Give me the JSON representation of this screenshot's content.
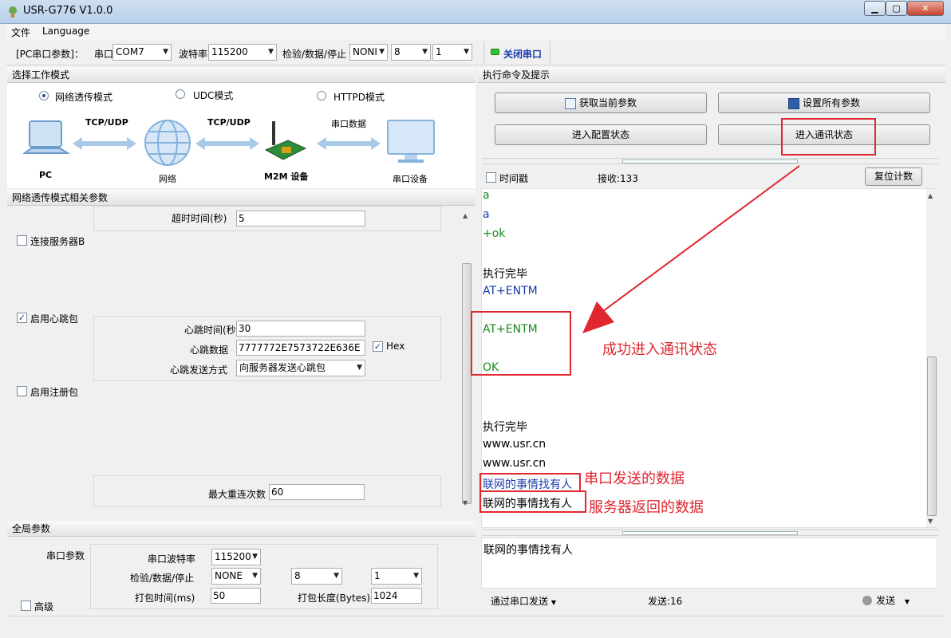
{
  "window": {
    "title": "USR-G776 V1.0.0",
    "btn_min": "▁",
    "btn_max": "▢",
    "btn_close": "✕"
  },
  "menu": [
    "文件",
    "Language"
  ],
  "toolbar": {
    "port_group_label": "[PC串口参数]：",
    "port_label": "串口号",
    "port_value": "COM7",
    "baud_label": "波特率",
    "baud_value": "115200",
    "check_label": "检验/数据/停止",
    "parity_value": "NONI",
    "data_bits_value": "8",
    "stop_bits_value": "1",
    "close_port_label": "关闭串口"
  },
  "left": {
    "mode_header": "选择工作模式",
    "modes": [
      "网络透传模式",
      "UDC模式",
      "HTTPD模式"
    ],
    "diagram": {
      "tcp1": "TCP/UDP",
      "tcp2": "TCP/UDP",
      "serial_data": "串口数据",
      "pc": "PC",
      "network": "网络",
      "m2m": "M2M 设备",
      "serial_device": "串口设备"
    },
    "params_header": "网络透传模式相关参数",
    "timeout_label": "超时时间(秒)",
    "timeout_value": "5",
    "connect_b_label": "连接服务器B",
    "heartbeat_enable_label": "启用心跳包",
    "heartbeat_time_label": "心跳时间(秒",
    "heartbeat_time_value": "30",
    "heartbeat_data_label": "心跳数据",
    "heartbeat_data_value": "7777772E7573722E636E",
    "hex_label": "Hex",
    "heartbeat_mode_label": "心跳发送方式",
    "heartbeat_mode_value": "向服务器发送心跳包",
    "register_enable_label": "启用注册包",
    "max_reconnect_label": "最大重连次数",
    "max_reconnect_value": "60",
    "global_header": "全局参数",
    "serial_params_label": "串口参数",
    "g_baud_label": "串口波特率",
    "g_baud_value": "115200",
    "g_check_label": "检验/数据/停止",
    "g_parity_value": "NONE",
    "g_data_value": "8",
    "g_stop_value": "1",
    "pack_time_label": "打包时间(ms)",
    "pack_time_value": "50",
    "pack_len_label": "打包长度(Bytes)",
    "pack_len_value": "1024",
    "advanced_label": "高级"
  },
  "right": {
    "header": "执行命令及提示",
    "btn_get": "获取当前参数",
    "btn_set": "设置所有参数",
    "btn_config": "进入配置状态",
    "btn_comm": "进入通讯状态",
    "timestamp_label": "时间戳",
    "recv_label": "接收:133",
    "reset_count": "复位计数",
    "log": [
      {
        "text": "a",
        "color": "#1a8a1a"
      },
      {
        "text": "a",
        "color": "#1a3ab0"
      },
      {
        "text": "+ok",
        "color": "#1a8a1a"
      },
      {
        "text": "执行完毕",
        "color": "#000000"
      },
      {
        "text": "AT+ENTM",
        "color": "#1a3ab0"
      },
      {
        "text": "AT+ENTM",
        "color": "#1a8a1a"
      },
      {
        "text": "OK",
        "color": "#1a8a1a"
      },
      {
        "text": "执行完毕",
        "color": "#000000"
      },
      {
        "text": "www.usr.cn",
        "color": "#000000"
      },
      {
        "text": "www.usr.cn",
        "color": "#000000"
      },
      {
        "text": "联网的事情找有人",
        "color": "#1a3ab0"
      },
      {
        "text": "联网的事情找有人",
        "color": "#000000"
      }
    ],
    "anno_success": "成功进入通讯状态",
    "anno_serial_sent": "串口发送的数据",
    "anno_server_return": "服务器返回的数据",
    "send_text": "联网的事情找有人",
    "send_via_label": "通过串口发送",
    "send_count": "发送:16",
    "send_button": "发送"
  },
  "colors": {
    "red_annotation": "#e0262f",
    "log_green": "#1a8a1a",
    "log_blue": "#1a3ab0"
  }
}
